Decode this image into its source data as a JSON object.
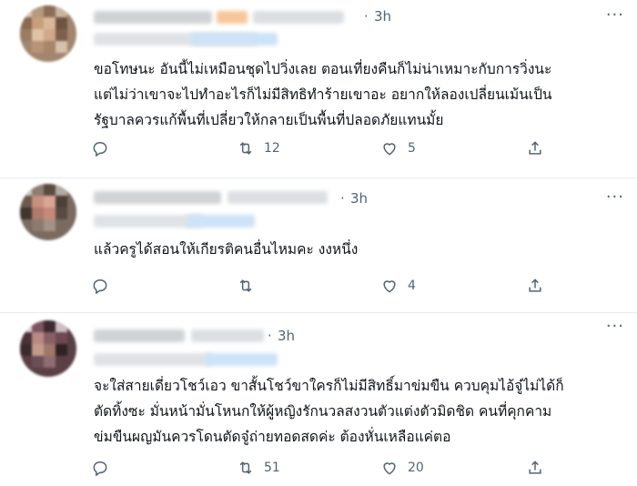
{
  "tweets": [
    {
      "time": "3h",
      "text_lines": [
        "ขอโทษนะ อันนี้ไม่เหมือนชุดไปวิ่งเลย ตอนเที่ยงคืนก็ไม่น่าเหมาะกับการวิ่งนะ",
        "แต่ไม่ว่าเขาจะไปทำอะไรก็ไม่มีสิทธิทำร้ายเขาอะ อยากให้ลองเปลี่ยนเม้นเป็น",
        "รัฐบาลควรแก้พื้นที่เปลี่ยวให้กลายเป็นพื้นที่ปลอดภัยแทนมั้ย"
      ],
      "retweets": "12",
      "likes": "5"
    },
    {
      "time": "3h",
      "text_lines": [
        "แล้วครูได้สอนให้เกียรติคนอื่นไหมคะ งงหนึ่ง"
      ],
      "retweets": "",
      "likes": "4"
    },
    {
      "time": "3h",
      "text_lines": [
        "จะใส่สายเดี่ยวโชว์เอว ขาสั้นโชว์ขาใครก็ไม่มีสิทธิ์มาข่มขืน ควบคุมไอ้จู๋ไม่ได้ก็",
        "ตัดทิ้งซะ มั่นหน้ามั่นโหนกให้ผู้หญิงรักนวลสงวนตัวแต่งตัวมิดชิด คนที่คุกคาม",
        "ข่มขืนผญมันควรโดนตัดจู๋ถ่ายทอดสดค่ะ ต้องหั่นเหลือแค่ตอ"
      ],
      "retweets": "51",
      "likes": "20"
    }
  ],
  "icons": {
    "reply": "reply-icon",
    "retweet": "retweet-icon",
    "like": "like-icon",
    "share": "share-icon",
    "more": "more-icon"
  },
  "colors": {
    "text": "#0f1419",
    "secondary": "#536471",
    "divider": "#e6ecf0"
  }
}
